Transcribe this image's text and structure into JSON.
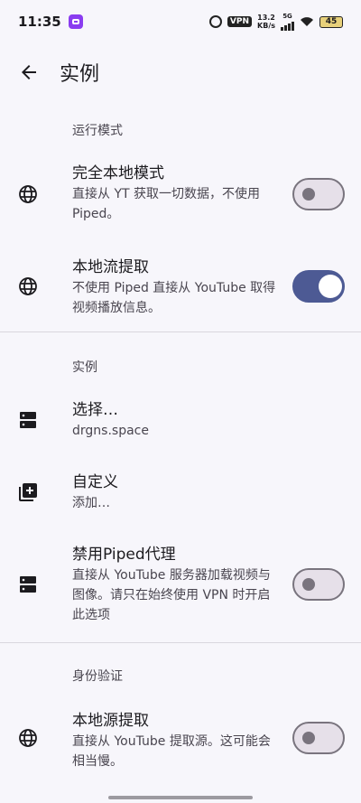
{
  "status_bar": {
    "time": "11:35",
    "vpn": "VPN",
    "speed_value": "13.2",
    "speed_unit": "KB/s",
    "network": "5G",
    "battery": "45"
  },
  "app_bar": {
    "title": "实例"
  },
  "sections": {
    "run_mode": {
      "header": "运行模式",
      "full_local": {
        "title": "完全本地模式",
        "summary": "直接从 YT 获取一切数据，不使用 Piped。",
        "enabled": false
      },
      "local_stream": {
        "title": "本地流提取",
        "summary": "不使用 Piped 直接从 YouTube 取得视频播放信息。",
        "enabled": true
      }
    },
    "instance": {
      "header": "实例",
      "select": {
        "title": "选择…",
        "summary": "drgns.space"
      },
      "custom": {
        "title": "自定义",
        "summary": "添加…"
      },
      "disable_proxy": {
        "title": "禁用Piped代理",
        "summary": "直接从 YouTube 服务器加载视频与图像。请只在始终使用 VPN 时开启此选项",
        "enabled": false
      }
    },
    "auth": {
      "header": "身份验证",
      "local_source": {
        "title": "本地源提取",
        "summary": "直接从 YouTube 提取源。这可能会相当慢。",
        "enabled": false
      }
    }
  },
  "colors": {
    "accent": "#4d5a94",
    "background": "#f7f6fb"
  },
  "icons": {
    "back": "arrow-left-icon",
    "globe": "globe-icon",
    "server": "server-icon",
    "add": "library-add-icon"
  }
}
